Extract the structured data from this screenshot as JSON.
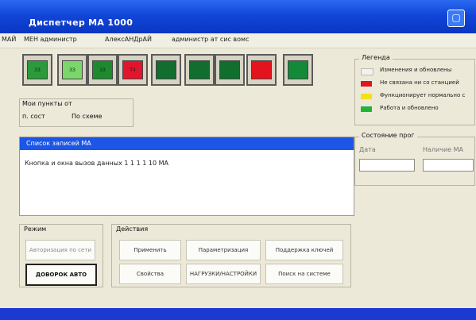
{
  "window": {
    "title": "Диспетчер МА 1000",
    "minimize_glyph": "▢"
  },
  "menu": {
    "items": [
      "МАЙ",
      "МЕН администр",
      "АлексАНДрАЙ",
      "администр ат сис вомс"
    ]
  },
  "toolbar": {
    "buttons": [
      {
        "label": "ЗЗ",
        "fill": "#2b9a3b"
      },
      {
        "label": "ЗЗ",
        "fill": "#7bd66b"
      },
      {
        "label": "ЗЗ",
        "fill": "#1e8a2e"
      },
      {
        "label": "Т4",
        "fill": "#e2152d"
      },
      {
        "label": "",
        "fill": "#126e2e"
      },
      {
        "label": "",
        "fill": "#126e2e"
      },
      {
        "label": "",
        "fill": "#126e2e"
      },
      {
        "label": "",
        "fill": "#e3141e"
      },
      {
        "label": "",
        "fill": "#128a38"
      }
    ]
  },
  "view_group": {
    "label": "Мои пункты от",
    "option_1": "п. сост",
    "option_2": "По схеме"
  },
  "list": {
    "header": "Список записей МА",
    "row_1": "Кнопка и окна вызов данных 1 1 1 1 10 МА"
  },
  "mode_group": {
    "label": "Режим",
    "btn_1": "Авторизация по сети",
    "btn_2": "ДОВОРОК АВТО"
  },
  "action_group": {
    "label": "Действия",
    "buttons": [
      "Применить",
      "Параметризация",
      "Поддержка ключей",
      "Свойства",
      "НАГРУЗКИ/НАСТРОЙКИ",
      "Поиск на системе"
    ]
  },
  "legend": {
    "title": "Легенда",
    "items": [
      {
        "color": "#f3f2ea",
        "text": "Изменения и обновлены"
      },
      {
        "color": "#e3141e",
        "text": "Не связана ни со станцией"
      },
      {
        "color": "#f2e01a",
        "text": "Функционирует нормально с"
      },
      {
        "color": "#21b43c",
        "text": "Работа и обновлено"
      }
    ]
  },
  "status_group": {
    "label": "Состояние прог",
    "field_1_label": "Дата",
    "field_2_label": "Наличие МА"
  },
  "colors": {
    "title_blue": "#1245d8",
    "list_header_blue": "#1c56e6",
    "face": "#ece9d8"
  }
}
